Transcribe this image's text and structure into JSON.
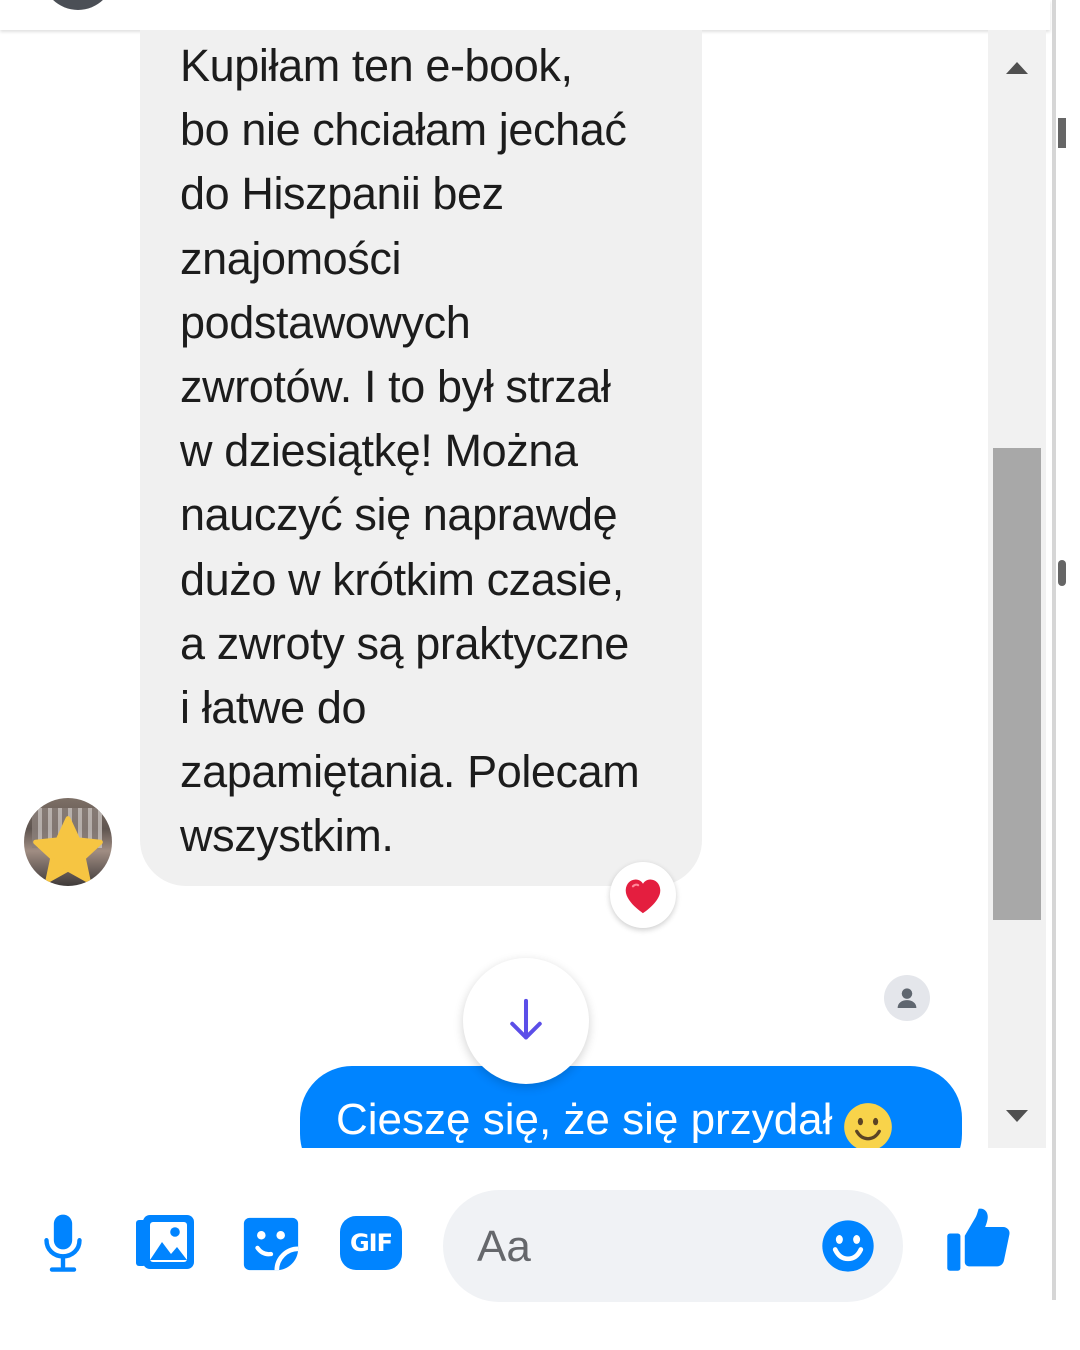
{
  "conversation": {
    "incoming_message": "Kupiłam ten e-book,\nbo nie chciałam jechać\ndo Hiszpanii bez\nznajomości\npodstawowych\nzwrotów. I to był strzał\nw dziesiątkę! Można\nnauczyć się naprawdę\ndużo w krótkim czasie,\na zwroty są praktyczne\ni łatwe do\nzapamiętania. Polecam\nwszystkim.",
    "incoming_reaction": "heart",
    "outgoing_message": "Cieszę się, że się przydał",
    "outgoing_emoji": "slightly-smiling-face"
  },
  "composer": {
    "placeholder": "Aa",
    "tools": [
      "microphone-icon",
      "photo-icon",
      "sticker-icon",
      "gif-icon"
    ],
    "gif_label": "GIF"
  },
  "colors": {
    "accent": "#0084ff",
    "incoming_bubble": "#f0f0f0",
    "reaction_heart": "#e41e3f",
    "scroll_arrow": "#5b4ee8"
  }
}
